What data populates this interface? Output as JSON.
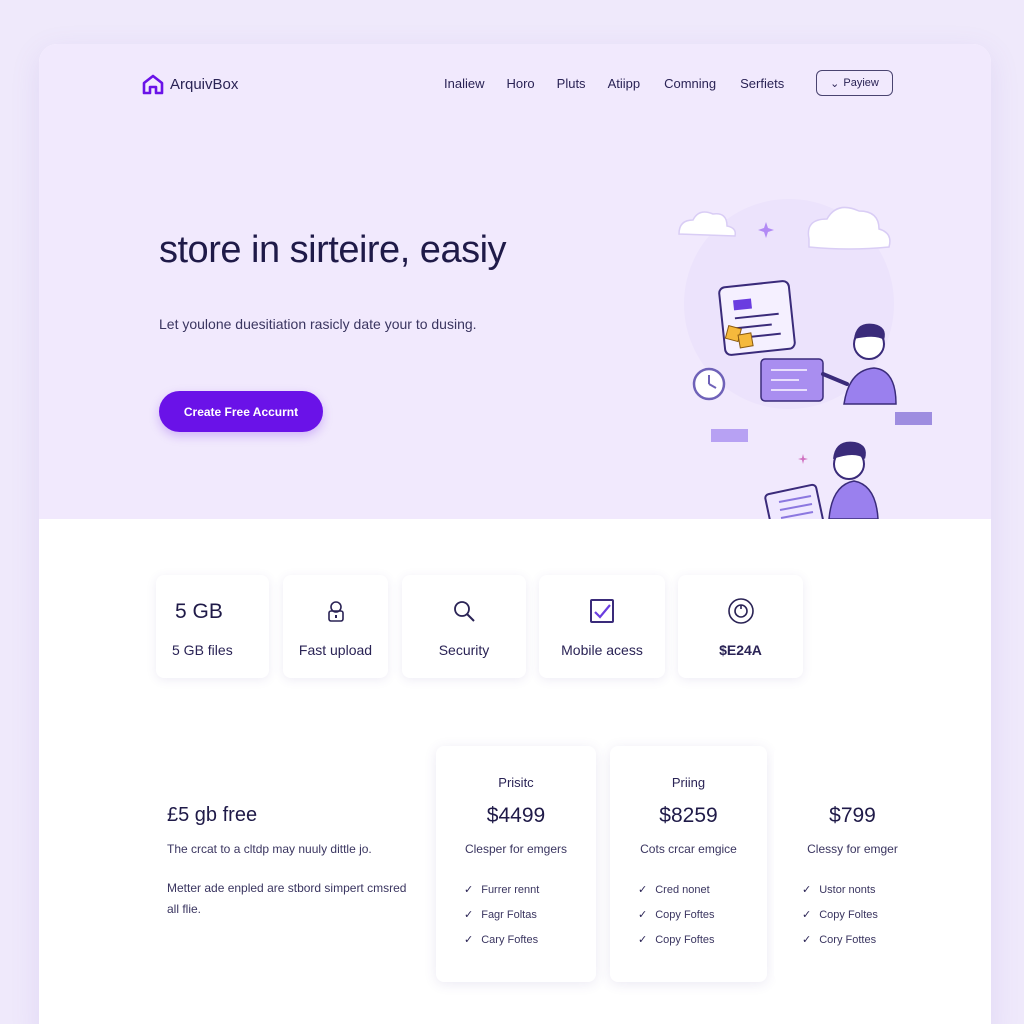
{
  "brand": {
    "name": "ArquivBox",
    "logo_icon": "house-logo-icon",
    "accent": "#6a12e8"
  },
  "nav": {
    "items": [
      "Inaliew",
      "Horo",
      "Pluts",
      "Atiipp",
      "Comning",
      "Serfiets"
    ],
    "preview_label": "Payiew",
    "preview_icon": "chevron-down-icon"
  },
  "hero": {
    "title": "store in sirteire, easiy",
    "subtitle": "Let youlone duesitiation rasicly date your to dusing.",
    "cta_label": "Create Free Accurnt"
  },
  "features": [
    {
      "big": "5 GB",
      "label": "5 GB files",
      "icon": ""
    },
    {
      "label": "Fast upload",
      "icon": "lock-icon"
    },
    {
      "label": "Security",
      "icon": "search-icon"
    },
    {
      "label": "Mobile acess",
      "icon": "checkbox-icon"
    },
    {
      "label": "$E24A",
      "icon": "clock-icon"
    }
  ],
  "pricing": {
    "free_title": "£5 gb free",
    "free_line1": "The crcat to a cltdp may nuuly dittle jo.",
    "free_line2": "Metter ade enpled are stbord simpert cmsred all flie.",
    "plans": [
      {
        "name": "Prisitc",
        "price": "$4499",
        "desc": "Clesper for emgers",
        "features": [
          "Furrer rennt",
          "Fagr Foltas",
          "Cary Foftes"
        ]
      },
      {
        "name": "Priing",
        "price": "$8259",
        "desc": "Cots crcar emgice",
        "features": [
          "Cred nonet",
          "Copy Foftes",
          "Copy Foftes"
        ]
      },
      {
        "name": "",
        "price": "$799",
        "desc": "Clessy for emger",
        "features": [
          "Ustor nonts",
          "Copy Foltes",
          "Cory Fottes"
        ]
      }
    ]
  }
}
